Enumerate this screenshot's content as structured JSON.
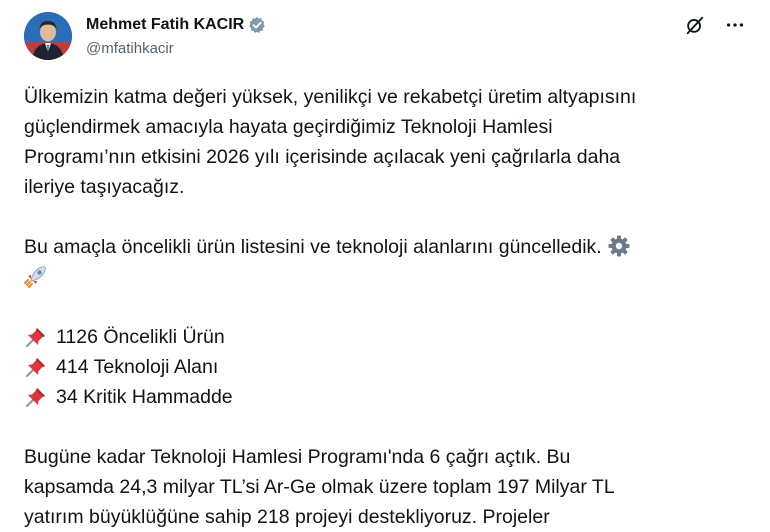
{
  "author": {
    "name": "Mehmet Fatih KACIR",
    "handle": "@mfatihkacir"
  },
  "icons": {
    "verified": "verified-badge-icon",
    "grok": "grok-icon",
    "more": "more-options-icon",
    "gear": "gear-icon",
    "rocket": "rocket-icon",
    "pin": "pushpin-icon"
  },
  "colors": {
    "text": "#0f1419",
    "secondary": "#536471",
    "badge": "#829aab"
  },
  "tweet": {
    "p1": [
      "Ülkemizin katma değeri yüksek, yenilikçi ve rekabetçi üretim altyapısını",
      "güçlendirmek amacıyla hayata geçirdiğimiz Teknoloji Hamlesi",
      "Programı’nın etkisini 2026 yılı içerisinde açılacak yeni çağrılarla daha",
      "ileriye taşıyacağız."
    ],
    "p2": "Bu amaçla öncelikli ürün listesini ve teknoloji alanlarını güncelledik.",
    "list": [
      "1126 Öncelikli Ürün",
      "414 Teknoloji Alanı",
      "34 Kritik Hammadde"
    ],
    "p3": [
      "Bugüne kadar Teknoloji Hamlesi Programı'nda 6 çağrı açtık. Bu",
      "kapsamda 24,3 milyar TL’si Ar-Ge olmak üzere toplam 197 Milyar TL",
      "yatırım büyüklüğüne sahip 218 projeyi destekliyoruz. Projeler"
    ]
  }
}
